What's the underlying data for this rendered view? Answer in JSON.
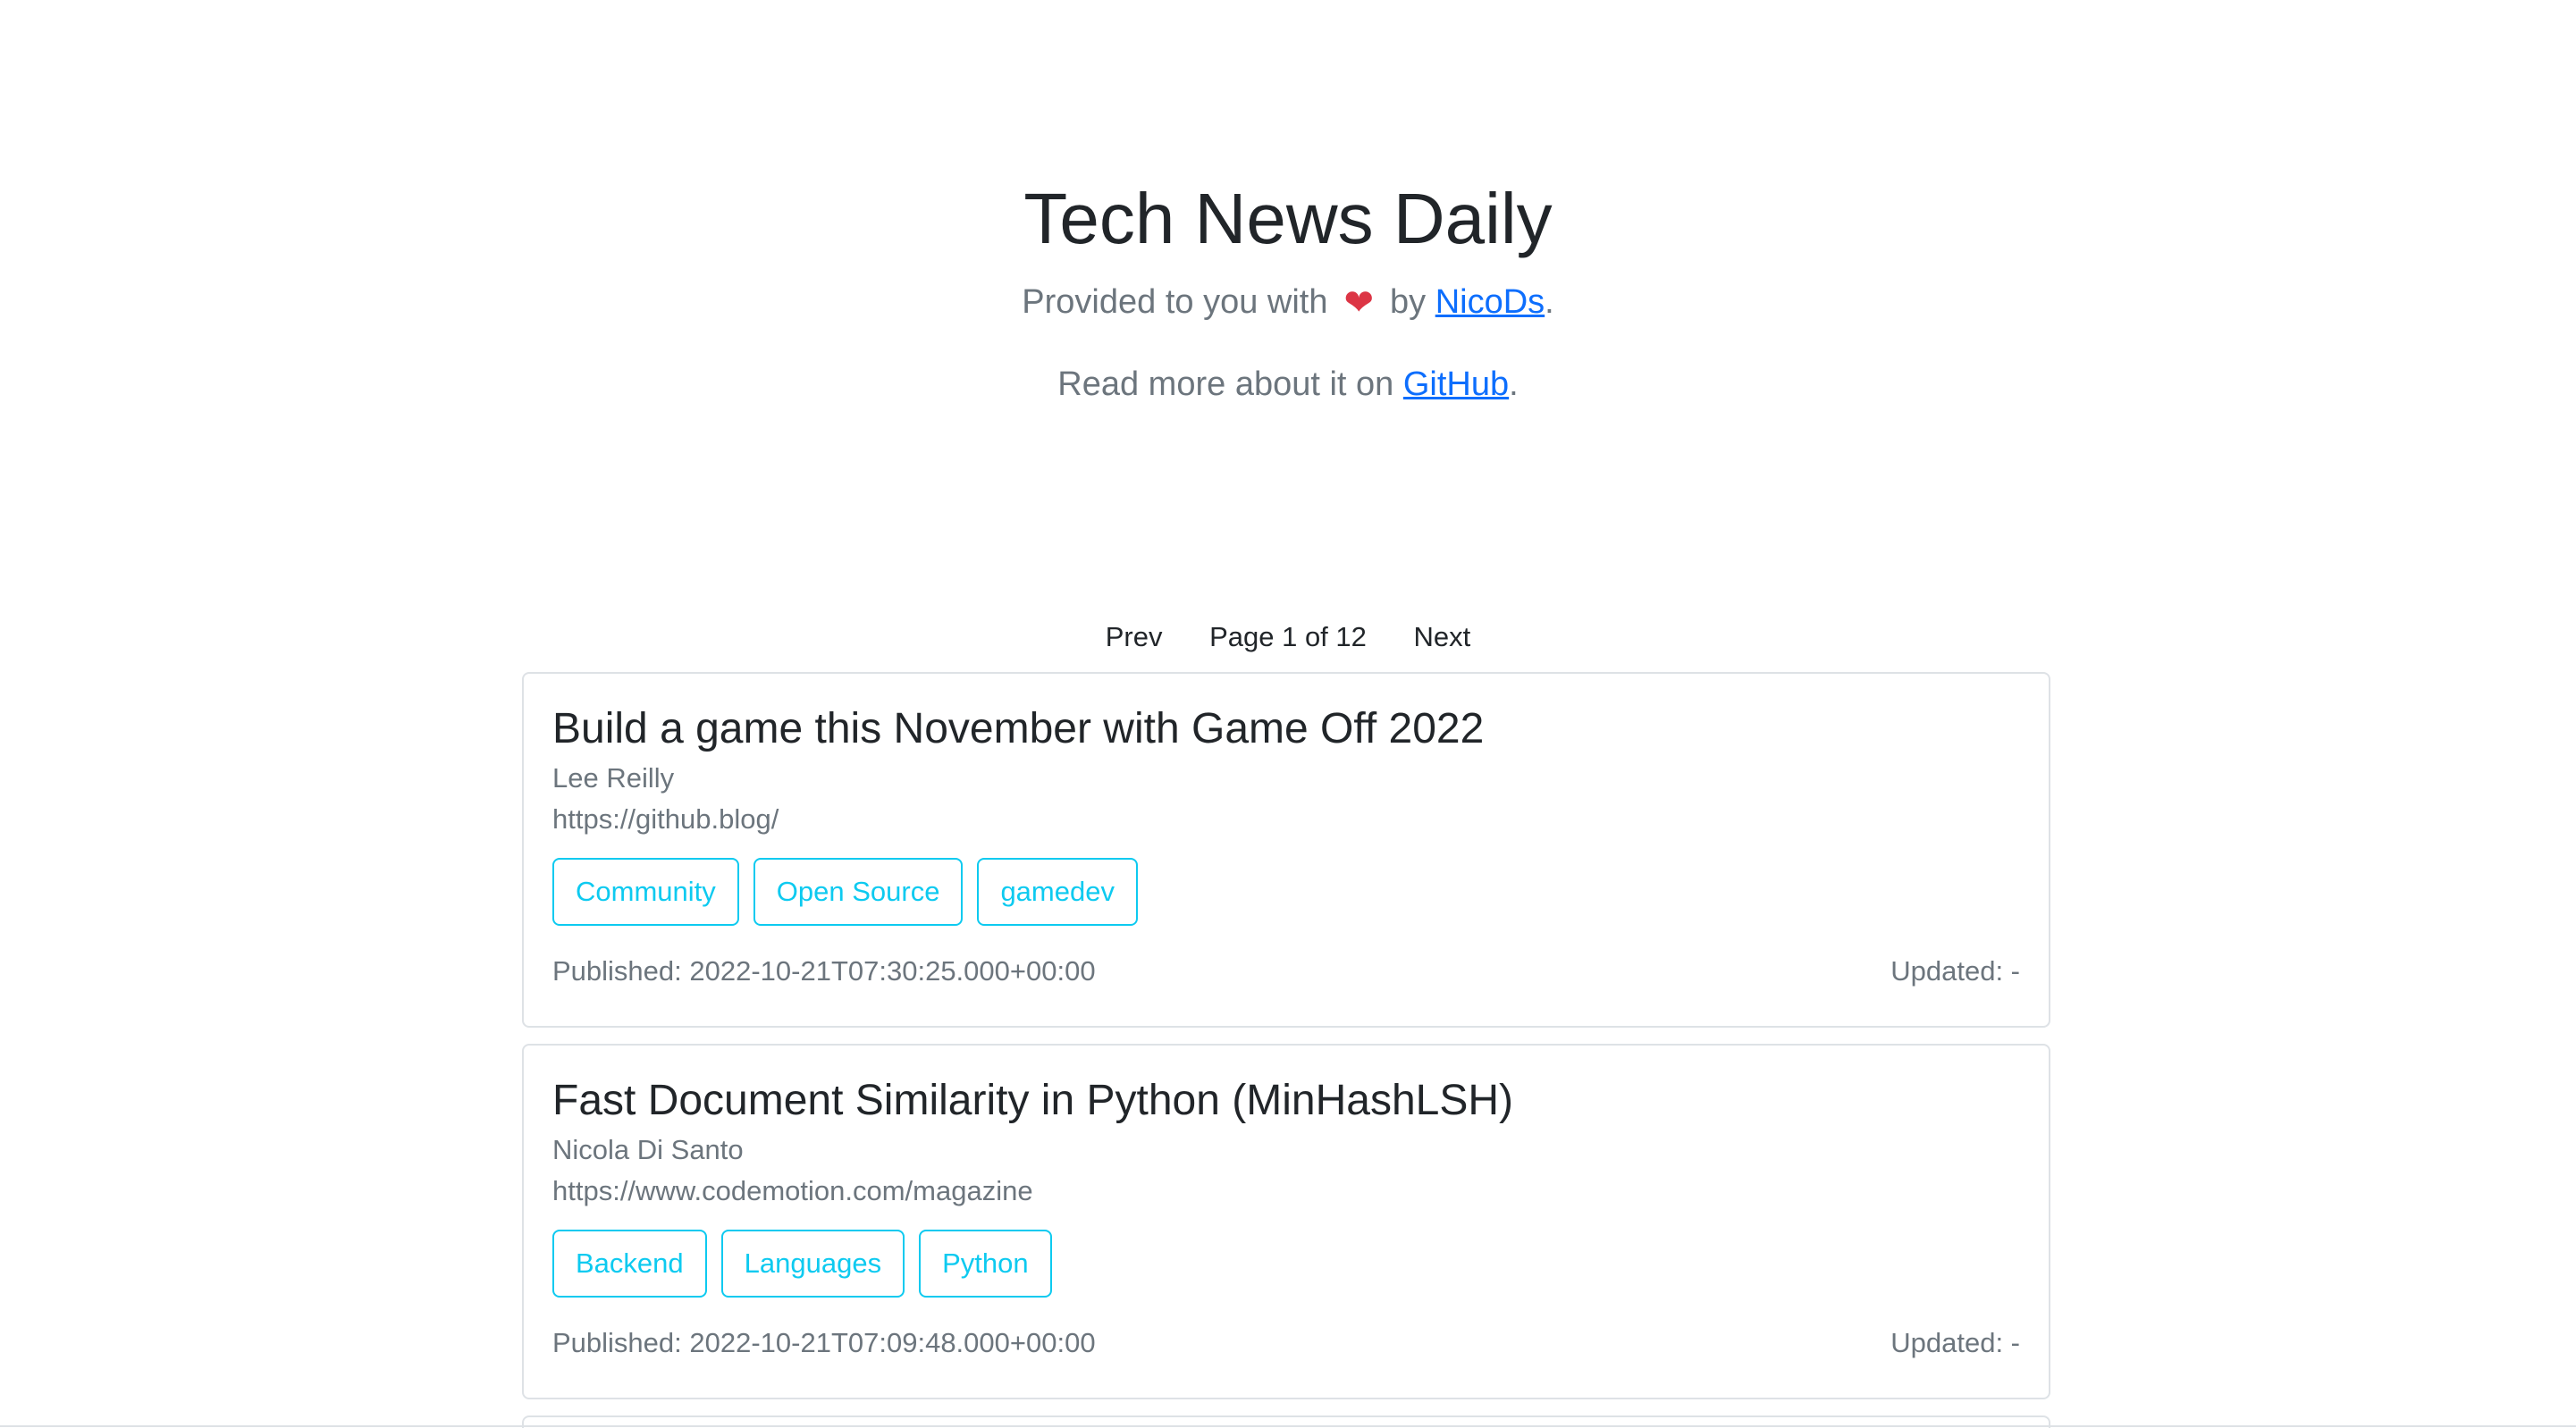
{
  "header": {
    "title": "Tech News Daily",
    "provided_prefix": "Provided to you with",
    "heart_icon": "❤",
    "provided_by": "by",
    "author_link": "NicoDs",
    "author_suffix": ".",
    "read_more_prefix": "Read more about it on",
    "github_link": "GitHub",
    "read_more_suffix": "."
  },
  "pagination": {
    "prev": "Prev",
    "page_label": "Page 1 of 12",
    "next": "Next"
  },
  "articles": [
    {
      "title": "Build a game this November with Game Off 2022",
      "author": "Lee Reilly",
      "source": "https://github.blog/",
      "tags": [
        "Community",
        "Open Source",
        "gamedev"
      ],
      "published": "Published: 2022-10-21T07:30:25.000+00:00",
      "updated": "Updated: -"
    },
    {
      "title": "Fast Document Similarity in Python (MinHashLSH)",
      "author": "Nicola Di Santo",
      "source": "https://www.codemotion.com/magazine",
      "tags": [
        "Backend",
        "Languages",
        "Python"
      ],
      "published": "Published: 2022-10-21T07:09:48.000+00:00",
      "updated": "Updated: -"
    }
  ],
  "colors": {
    "link": "#0d6efd",
    "tag": "#0dcaf0",
    "muted": "#6c757d",
    "heart": "#dc3545"
  }
}
